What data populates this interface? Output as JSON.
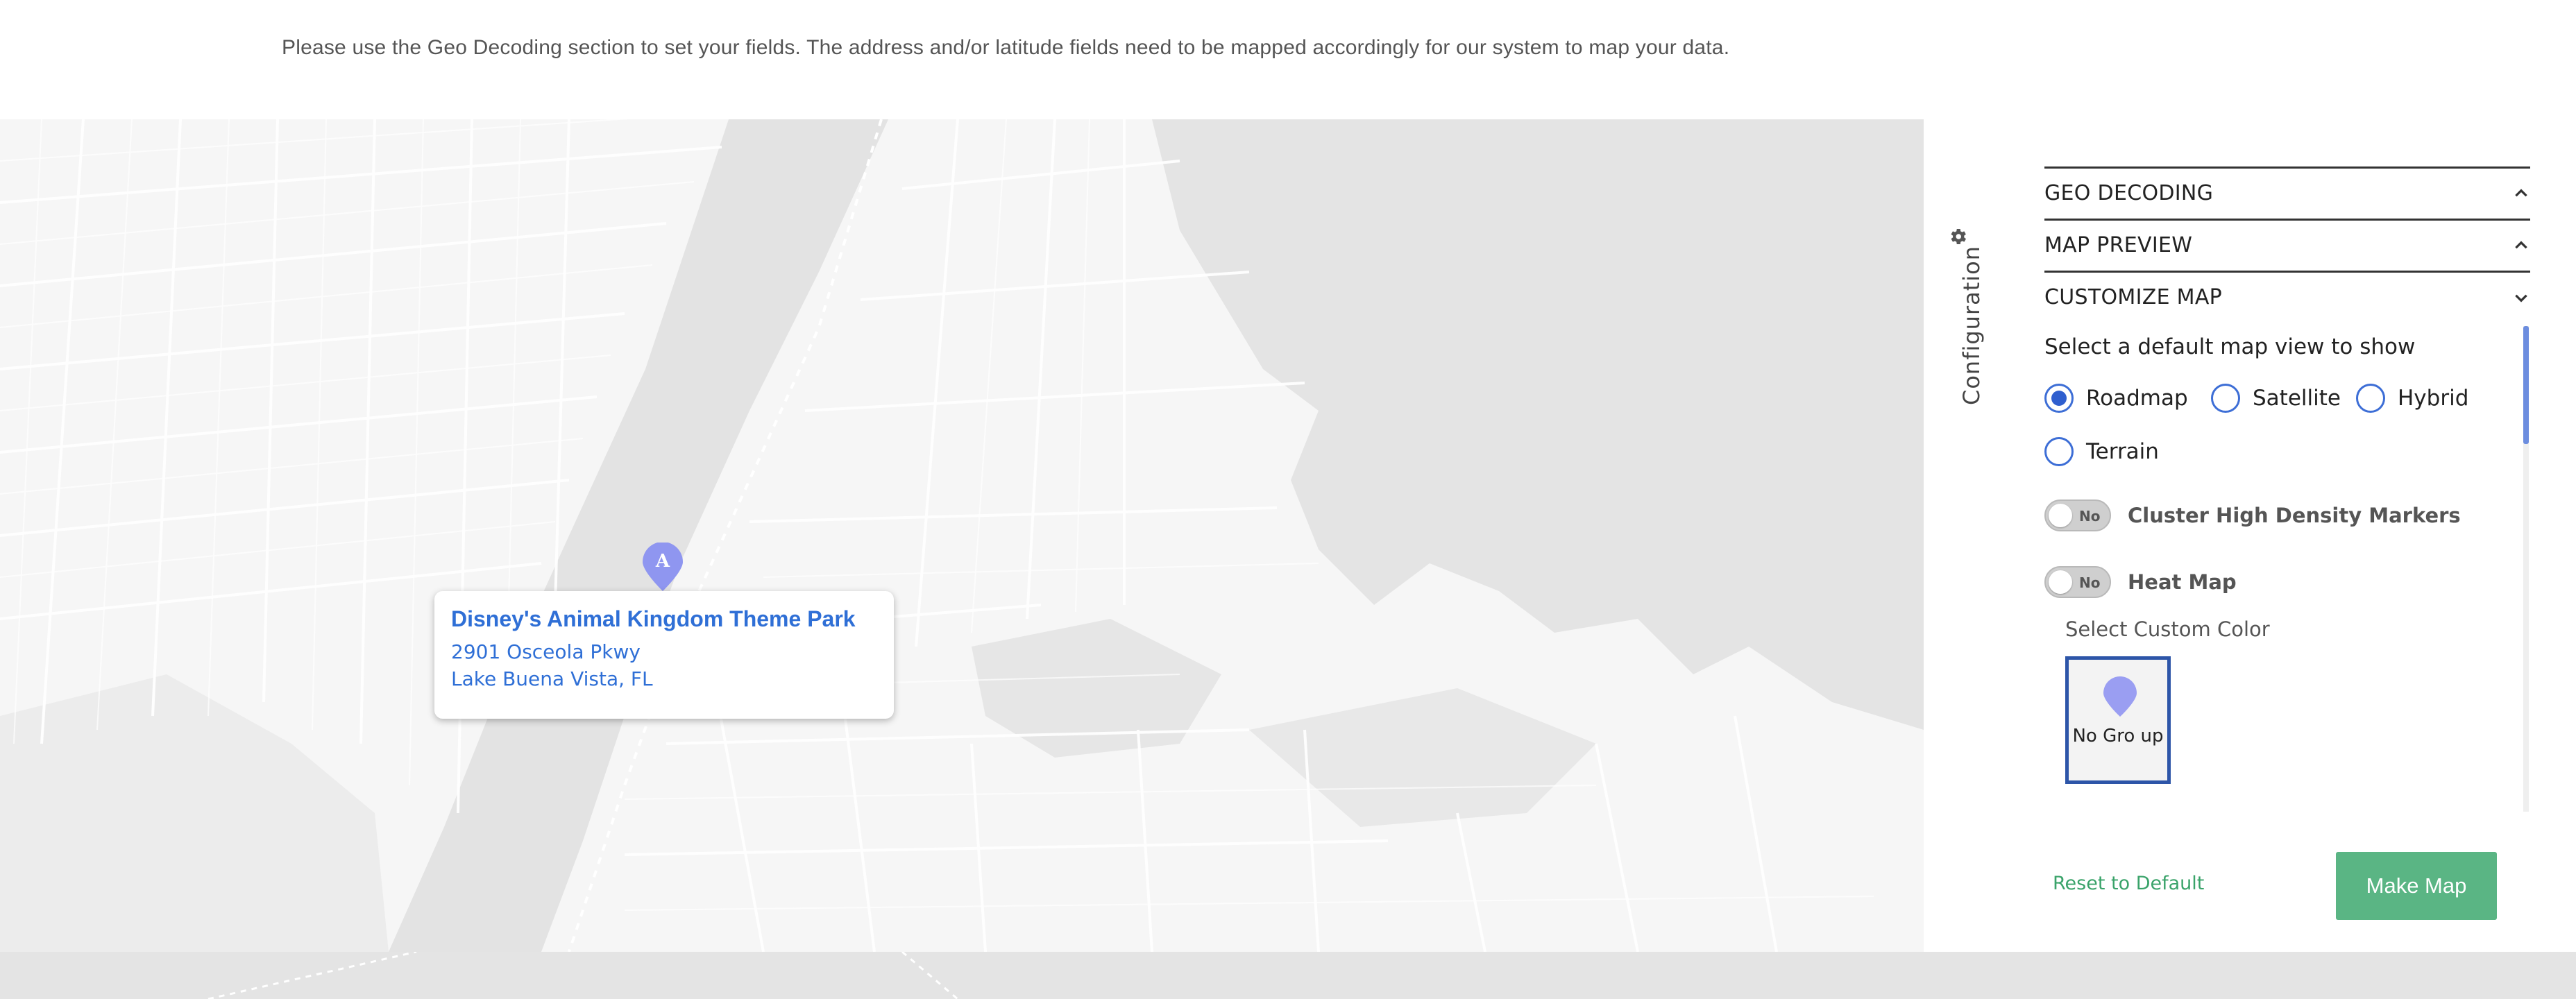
{
  "notice": "Please use the Geo Decoding section to set your fields. The address and/or latitude fields need to be mapped accordingly for our system to map your data.",
  "map": {
    "marker_letter": "A",
    "marker_color": "#8f96f0",
    "info": {
      "title": "Disney's Animal Kingdom Theme Park",
      "address_line1": "2901 Osceola Pkwy",
      "address_line2": "Lake Buena Vista, FL"
    }
  },
  "sidebar": {
    "config_label": "Configuration",
    "gear_icon": "gear-icon",
    "sections": [
      {
        "label": "GEO DECODING",
        "state": "collapsed"
      },
      {
        "label": "MAP PREVIEW",
        "state": "collapsed"
      },
      {
        "label": "CUSTOMIZE MAP",
        "state": "expanded"
      }
    ],
    "customize": {
      "view_heading": "Select a default map view to show",
      "views": [
        {
          "label": "Roadmap",
          "selected": true
        },
        {
          "label": "Satellite",
          "selected": false
        },
        {
          "label": "Hybrid",
          "selected": false
        },
        {
          "label": "Terrain",
          "selected": false
        }
      ],
      "cluster": {
        "toggle_text": "No",
        "label": "Cluster High Density Markers"
      },
      "heatmap": {
        "toggle_text": "No",
        "label": "Heat Map"
      },
      "custom_color_label": "Select Custom Color",
      "swatch": {
        "name": "No Gro up",
        "color": "#9a9ef2"
      }
    },
    "actions": {
      "reset_label": "Reset to Default",
      "make_map_label": "Make Map"
    }
  }
}
